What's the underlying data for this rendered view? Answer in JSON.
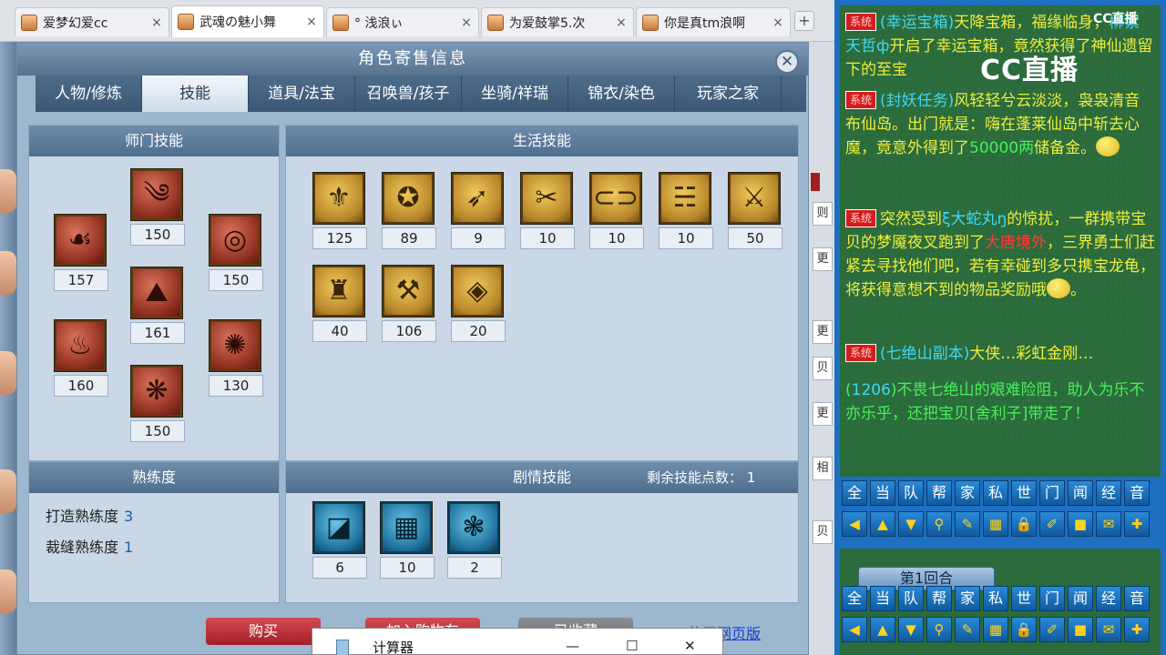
{
  "browser": {
    "tabs": [
      {
        "title": "爱梦幻爱cc",
        "active": false
      },
      {
        "title": "武魂の魅小舞",
        "active": true
      },
      {
        "title": "° 浅浪ぃ",
        "active": false
      },
      {
        "title": "为爱鼓掌5.次",
        "active": false
      },
      {
        "title": "你是真tm浪啊",
        "active": false
      }
    ],
    "close_glyph": "×",
    "new_tab_glyph": "+"
  },
  "side_buttons": [
    "则",
    "更",
    "更",
    "贝",
    "更",
    "相",
    "贝"
  ],
  "dialog": {
    "title": "角色寄售信息",
    "close_glyph": "✕",
    "tabs": [
      "人物/修炼",
      "技能",
      "道具/法宝",
      "召唤兽/孩子",
      "坐骑/祥瑞",
      "锦衣/染色",
      "玩家之家"
    ],
    "active_tab": 1,
    "school_skills": {
      "title": "师门技能",
      "items": [
        {
          "value": "157",
          "glyph": "☙"
        },
        {
          "value": "150",
          "glyph": "༄"
        },
        {
          "value": "161",
          "glyph": "⛰"
        },
        {
          "value": "150",
          "glyph": "◎"
        },
        {
          "value": "160",
          "glyph": "♨"
        },
        {
          "value": "150",
          "glyph": "❋"
        },
        {
          "value": "130",
          "glyph": "✺"
        }
      ]
    },
    "life_skills": {
      "title": "生活技能",
      "items": [
        {
          "value": "125",
          "glyph": "⚜"
        },
        {
          "value": "89",
          "glyph": "✪"
        },
        {
          "value": "9",
          "glyph": "➶"
        },
        {
          "value": "10",
          "glyph": "✂"
        },
        {
          "value": "10",
          "glyph": "⊂⊃"
        },
        {
          "value": "10",
          "glyph": "☵"
        },
        {
          "value": "50",
          "glyph": "⚔"
        },
        {
          "value": "40",
          "glyph": "♜"
        },
        {
          "value": "106",
          "glyph": "⚒"
        },
        {
          "value": "20",
          "glyph": "◈"
        }
      ]
    },
    "proficiency": {
      "title": "熟练度",
      "rows": [
        {
          "label": "打造熟练度",
          "value": "3"
        },
        {
          "label": "裁缝熟练度",
          "value": "1"
        }
      ]
    },
    "story_skills": {
      "title": "剧情技能",
      "remaining_label": "剩余技能点数：",
      "remaining_value": "1",
      "items": [
        {
          "value": "6",
          "glyph": "◪"
        },
        {
          "value": "10",
          "glyph": "▦"
        },
        {
          "value": "2",
          "glyph": "❃"
        }
      ]
    },
    "buttons": {
      "buy": "购买",
      "cart": "加入购物车",
      "fav": "已收藏",
      "web": "使用网页版"
    }
  },
  "calculator": {
    "title": "计算器",
    "min": "—",
    "max": "☐",
    "close": "✕"
  },
  "chat": {
    "watermark": "CC直播",
    "watermark_small": "CC直播",
    "messages": [
      {
        "sys": "系统",
        "parts": [
          {
            "t": "(幸运宝箱)",
            "c": "cyan"
          },
          {
            "t": "天降宝箱，福缘临身，",
            "c": ""
          },
          {
            "t": "柳絮天哲ф",
            "c": "cyan"
          },
          {
            "t": "开启了幸运宝箱，竟然获得了神仙遗留下的至宝",
            "c": ""
          }
        ]
      },
      {
        "sys": "系统",
        "parts": [
          {
            "t": "(封妖任务)",
            "c": "cyan"
          },
          {
            "t": "风轻轻兮云淡淡，袅袅清音布仙岛。出门就是：嗨",
            "c": ""
          },
          {
            "t": "在蓬莱仙岛中斩去心魔，竟意外得到了",
            "c": ""
          },
          {
            "t": "50000两",
            "c": "green"
          },
          {
            "t": "储备金。",
            "c": ""
          }
        ]
      },
      {
        "sys": "系统",
        "parts": [
          {
            "t": "突然受到",
            "c": ""
          },
          {
            "t": "ξ大蛇丸ŋ",
            "c": "cyan"
          },
          {
            "t": "的惊扰，一群携带宝贝的梦魇夜叉跑到了",
            "c": ""
          },
          {
            "t": "大唐境外",
            "c": "red"
          },
          {
            "t": "，三界勇士们赶紧去寻找他们吧，若有幸碰到多只携宝龙龟，将获得意想不到的物品奖励哦",
            "c": ""
          },
          {
            "t": "。",
            "c": ""
          }
        ]
      },
      {
        "sys": "系统",
        "parts": [
          {
            "t": "(七绝山副本)",
            "c": "cyan"
          },
          {
            "t": "大侠…彩虹金刚…",
            "c": ""
          }
        ]
      },
      {
        "sys": "",
        "parts": [
          {
            "t": "(",
            "c": ""
          },
          {
            "t": "1206",
            "c": "cyan"
          },
          {
            "t": ")不畏七绝山的艰难险阻，助人为乐不亦乐乎，还把宝贝[舍利子]带走了！",
            "c": ""
          }
        ]
      }
    ],
    "channels": [
      "全",
      "当",
      "队",
      "帮",
      "家",
      "私",
      "世",
      "门",
      "闻",
      "经",
      "音"
    ],
    "tools": [
      "◀",
      "▲",
      "▼",
      "⚲",
      "✎",
      "▦",
      "🔒",
      "✐",
      "■",
      "✉",
      "✚"
    ],
    "round_label": "第1回合"
  }
}
